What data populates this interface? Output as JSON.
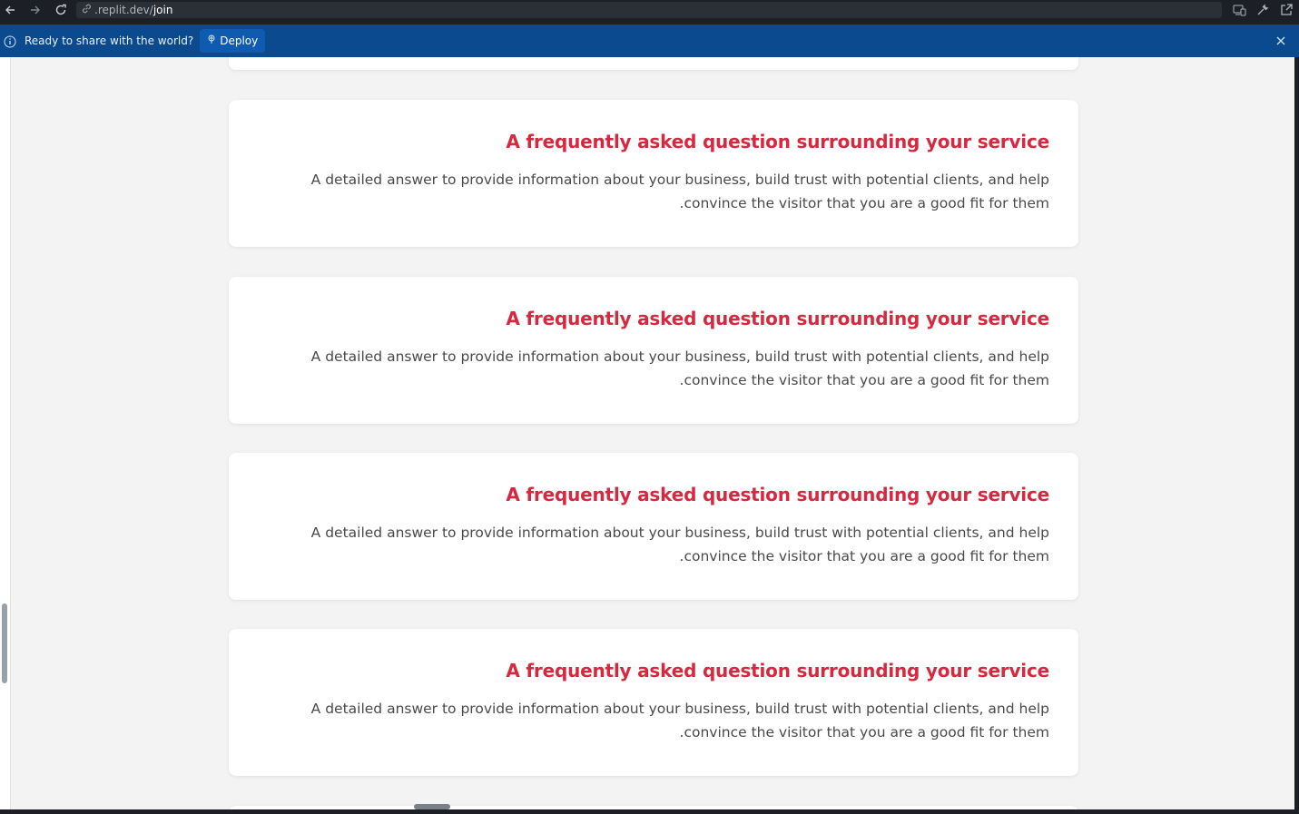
{
  "browser": {
    "url_host": ".replit.dev/",
    "url_path": "join",
    "icons": [
      "back-arrow-icon",
      "forward-arrow-icon",
      "reload-icon",
      "link-icon",
      "devices-icon",
      "wrench-icon",
      "external-link-icon"
    ]
  },
  "banner": {
    "message": "Ready to share with the world?",
    "deploy_label": "Deploy",
    "colors": {
      "background": "#0b4a8f",
      "button": "#0f5bb0"
    }
  },
  "faq": {
    "heading_color": "#d8283f",
    "items": [
      {
        "question": "A frequently asked question surrounding your service",
        "answer": "A detailed answer to provide information about your business, build trust with potential clients, and help convince the visitor that you are a good fit for them."
      },
      {
        "question": "A frequently asked question surrounding your service",
        "answer": "A detailed answer to provide information about your business, build trust with potential clients, and help convince the visitor that you are a good fit for them."
      },
      {
        "question": "A frequently asked question surrounding your service",
        "answer": "A detailed answer to provide information about your business, build trust with potential clients, and help convince the visitor that you are a good fit for them."
      },
      {
        "question": "A frequently asked question surrounding your service",
        "answer": "A detailed answer to provide information about your business, build trust with potential clients, and help convince the visitor that you are a good fit for them."
      }
    ]
  }
}
